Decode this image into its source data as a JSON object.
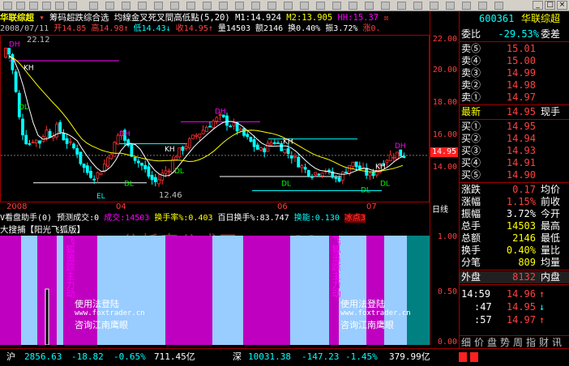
{
  "header": {
    "stock_name": "华联综超",
    "formula_line": "筹码超跌综合选  均線金叉死叉間高低點(5,20)",
    "m1": "M1:14.924",
    "m2": "M2:13.905",
    "hh": "HH:15.37",
    "close_icon": "☒"
  },
  "kline": {
    "date": "2008/07/11",
    "open": "开14.85",
    "high": "高14.98",
    "low": "低14.43",
    "close": "收14.95",
    "vol": "量14503",
    "amount": "额2146",
    "turnover": "换0.40%",
    "amplitude": "振3.72%",
    "change": "涨0."
  },
  "price_axis": [
    "22.00",
    "20.00",
    "18.00",
    "16.00",
    "14.00"
  ],
  "axis_lines": {
    "high_label": "22.12",
    "low_label": "12.46",
    "price_flag": "14.95"
  },
  "chart_tags": {
    "dh": "DH",
    "kh": "KH",
    "dl": "DL",
    "el": "EL"
  },
  "months": [
    "2008",
    "04",
    "06",
    "07"
  ],
  "daily_label": "日线",
  "indicator": {
    "name": "V看盘助手(0)",
    "pred": "预测成交:0",
    "vol": "成交:14503",
    "turnover": "换手率%:0.403",
    "hundred_day": "百日换手%:83.747",
    "extra": "换能:0.130",
    "tail": "冰点3"
  },
  "indicator2": {
    "name": "大搜捕【阳光飞狐版】"
  },
  "watermark": "分析家公式网www.88gs.com",
  "bars_text": {
    "v1": "飞狐追踪主力动",
    "promo1": "使用法登陆",
    "site": "www.foxtrader.cn",
    "contact": "咨询江南鹰眼",
    "v2": "飞狐追踪主力动"
  },
  "bars_axis": [
    "1.00",
    "0.50",
    "0.00"
  ],
  "right_panel": {
    "code": "600361",
    "name": "华联综超",
    "weibi_label": "委比",
    "weibi_value": "-29.53%",
    "weicha_label": "委差",
    "sells": [
      {
        "label": "卖⑤",
        "price": "15.01"
      },
      {
        "label": "卖④",
        "price": "15.00"
      },
      {
        "label": "卖③",
        "price": "14.99"
      },
      {
        "label": "卖②",
        "price": "14.98"
      },
      {
        "label": "卖①",
        "price": "14.97"
      }
    ],
    "latest_label": "最新",
    "latest_value": "14.95",
    "xianshou_label": "现手",
    "buys": [
      {
        "label": "买①",
        "price": "14.95"
      },
      {
        "label": "买②",
        "price": "14.94"
      },
      {
        "label": "买③",
        "price": "14.93"
      },
      {
        "label": "买④",
        "price": "14.91"
      },
      {
        "label": "买⑤",
        "price": "14.90"
      }
    ],
    "stats": [
      {
        "a": "涨跌",
        "b": "0.17",
        "c": "均价"
      },
      {
        "a": "涨幅",
        "b": "1.15%",
        "c": "前收"
      },
      {
        "a": "振幅",
        "b": "3.72%",
        "c": "今开"
      },
      {
        "a": "总手",
        "b": "14503",
        "c": "最高"
      },
      {
        "a": "总额",
        "b": "2146",
        "c": "最低"
      },
      {
        "a": "换手",
        "b": "0.40%",
        "c": "量比"
      },
      {
        "a": "分笔",
        "b": "809",
        "c": "均量"
      }
    ],
    "waipan_label": "外盘",
    "waipan_value": "8132",
    "neipan_label": "内盘",
    "ticks": [
      {
        "time": "14:59",
        "price": "14.96",
        "arrow": "↑"
      },
      {
        "time": ":47",
        "price": "14.95",
        "arrow": "↓"
      },
      {
        "time": ":57",
        "price": "14.97",
        "arrow": "↑"
      }
    ],
    "tabs": [
      "细",
      "价",
      "盘",
      "势",
      "周",
      "指",
      "财",
      "讯"
    ]
  },
  "bottom": {
    "sh_label": "沪",
    "sh_index": "2856.63",
    "sh_change": "-18.82",
    "sh_pct": "-0.65%",
    "sh_amount": "711.45亿",
    "sz_label": "深",
    "sz_index": "10031.38",
    "sz_change": "-147.23",
    "sz_pct": "-1.45%",
    "sz_amount": "379.99亿"
  },
  "colors": {
    "up": "#ff3030",
    "down": "#00ffff",
    "yellow": "#ffff00",
    "magenta": "#ff00ff",
    "green": "#00ff00",
    "bar_magenta": "#c000c0",
    "bar_blue": "#99ccff"
  }
}
